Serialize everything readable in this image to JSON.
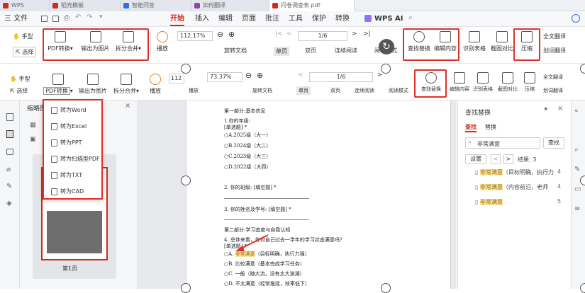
{
  "tabs": [
    {
      "label": "WPS",
      "color": "#d4281c"
    },
    {
      "label": "稻壳模板",
      "color": "#d4281c"
    },
    {
      "label": "智能问答",
      "color": "#2f6fe4"
    },
    {
      "label": "如何翻译",
      "color": "#8e44ad"
    },
    {
      "label": "问卷调查表.pdf",
      "color": "#d4281c"
    }
  ],
  "menubar": {
    "file": "三 文件",
    "items": [
      "开始",
      "插入",
      "编辑",
      "页面",
      "批注",
      "工具",
      "保护",
      "转换"
    ],
    "active": "开始",
    "ai": "WPS AI"
  },
  "ribbon_top": {
    "hand": "手型",
    "select": "选择",
    "pdf_convert": "PDF转换",
    "export_image": "输出为图片",
    "split_merge": "拆分合并",
    "play": "播放",
    "zoom": "112.17%",
    "page": "1/6",
    "single": "单页",
    "double": "双页",
    "continuous": "连续阅读",
    "rotate": "旋转文档",
    "read_mode": "阅读模式",
    "find_replace": "查找替换",
    "compare": "编辑内容",
    "recognize_table": "识别表格",
    "screenshot_compare": "截图对比",
    "compress": "压缩",
    "translate_all": "全文翻译",
    "translate_sel": "划词翻译"
  },
  "ribbon_bottom": {
    "hand": "手型",
    "select": "选择",
    "pdf_convert": "PDF转换",
    "export_image": "输出为图片",
    "split_merge": "拆分合并",
    "play": "播放",
    "zoom": "73.37%",
    "page": "1/6",
    "single": "单页",
    "double": "双页",
    "continuous": "连续阅读",
    "rotate": "旋转文档",
    "read_mode": "阅读模式",
    "find_replace": "查找替换",
    "edit_content": "编辑内容",
    "recognize_table": "识别表格",
    "screenshot_compare": "截图对比",
    "compress": "压缩",
    "translate_all": "全文翻译",
    "translate_sel": "划词翻译",
    "zoom_partial": "112"
  },
  "dropdown": [
    "转为Word",
    "转为Excel",
    "转为PPT",
    "转为扫描型PDF",
    "转为TXT",
    "转为CAD"
  ],
  "thumbnails": {
    "title": "缩略图",
    "page_label": "第1页"
  },
  "document": {
    "lines": [
      "第一部分:基本信息",
      "1.你的年级:",
      "[单选题] *",
      "○A.2025级（大一）",
      "○B.2024级（大二）",
      "○C.2023级（大三）",
      "○D.2022级（大四）",
      "2. 你的班级: [填空题] *",
      "3. 你的姓名及学号: [填空题] *",
      "第二部分:学习态度与自我认知",
      "4. 总体来看，你对自己过去一学年的学习状态满意吗?",
      "[单选题] *",
      "○A. 非常满意（目标明确，执行力强）",
      "○B. 比较满意（基本完成学习任务）",
      "○C. 一般（随大流，没有太大波澜）",
      "○D. 不太满意（经常拖延，效率低下）"
    ],
    "highlight": "非常满意"
  },
  "find_panel": {
    "title": "查找替换",
    "tab_find": "查找",
    "tab_replace": "替换",
    "query": "非常满意",
    "search_btn": "查找",
    "settings": "设置",
    "result_label": "结果: 3",
    "results": [
      {
        "hit": "非常满意",
        "rest": "（目标明确，执行力",
        "page": "4"
      },
      {
        "hit": "非常满意",
        "rest": "（内容前沿，老师",
        "page": "4"
      },
      {
        "hit": "非常满意",
        "rest": "",
        "page": "5"
      }
    ]
  },
  "colors": {
    "accent": "#d4281c",
    "box": "#e0302a"
  }
}
